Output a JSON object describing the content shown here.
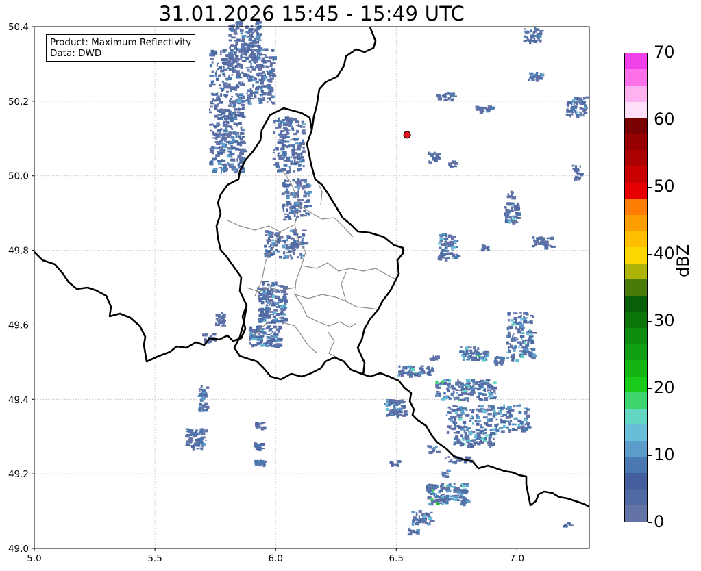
{
  "title": "31.01.2026 15:45 - 15:49 UTC",
  "info": {
    "product_line": "Product: Maximum Reflectivity",
    "data_line": "Data: DWD"
  },
  "map": {
    "lon_range": [
      5.0,
      7.3
    ],
    "lat_range": [
      49.0,
      50.4
    ],
    "x_ticks": [
      "5.0",
      "5.5",
      "6.0",
      "6.5",
      "7.0"
    ],
    "y_ticks": [
      "49.0",
      "49.2",
      "49.4",
      "49.6",
      "49.8",
      "50.0",
      "50.2",
      "50.4"
    ],
    "grid": true,
    "marker": {
      "lon": 6.545,
      "lat": 50.11,
      "color": "#e8141e"
    }
  },
  "colorbar": {
    "unit": "dBZ",
    "range": [
      0,
      70
    ],
    "ticks": [
      "0",
      "10",
      "20",
      "30",
      "40",
      "50",
      "60",
      "70"
    ],
    "colors": [
      "#6373a8",
      "#4f6aa3",
      "#455f9e",
      "#4a79b0",
      "#5b9ccb",
      "#67bed6",
      "#63d6c3",
      "#3cd46c",
      "#1acc1a",
      "#13b513",
      "#11a011",
      "#0c8c0c",
      "#0b740b",
      "#085f08",
      "#4a7a08",
      "#aeb407",
      "#ffd700",
      "#ffbf00",
      "#ff9e00",
      "#ff7d00",
      "#e60000",
      "#c80000",
      "#aa0000",
      "#960000",
      "#780000",
      "#ffe0f8",
      "#ffb2f2",
      "#ff70ea",
      "#ef40ea"
    ]
  }
}
